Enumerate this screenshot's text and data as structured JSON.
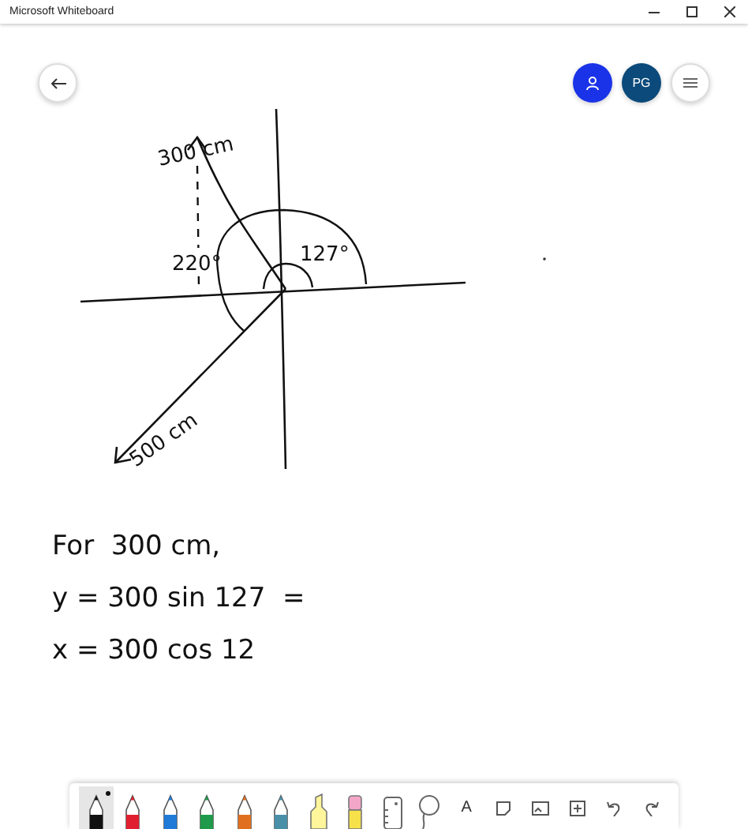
{
  "window": {
    "title": "Microsoft Whiteboard"
  },
  "header": {
    "avatars": [
      {
        "kind": "icon",
        "color": "#1a33e8"
      },
      {
        "kind": "initials",
        "initials": "PG",
        "color": "#0b4a7a"
      }
    ]
  },
  "canvas": {
    "labels": [
      {
        "text": "300 cm"
      },
      {
        "text": "220°"
      },
      {
        "text": "127°"
      },
      {
        "text": "500 cm"
      }
    ],
    "notes": [
      "For  300 cm,",
      "y = 300 sin 127  =",
      "x = 300 cos 12"
    ]
  },
  "toolbar": {
    "tools": [
      {
        "kind": "pen",
        "color": "#111111",
        "selected": true
      },
      {
        "kind": "pen",
        "color": "#e02030",
        "selected": false
      },
      {
        "kind": "pen",
        "color": "#1f7ad8",
        "selected": false
      },
      {
        "kind": "pen",
        "color": "#1f9a4a",
        "selected": false
      },
      {
        "kind": "pen",
        "color": "#e07020",
        "selected": false
      },
      {
        "kind": "pen",
        "color": "#4a8fa8",
        "selected": false
      },
      {
        "kind": "highlighter",
        "selected": false
      },
      {
        "kind": "eraser",
        "selected": false
      },
      {
        "kind": "ruler",
        "selected": false
      },
      {
        "kind": "lasso",
        "selected": false
      },
      {
        "kind": "text",
        "label": "A",
        "selected": false
      },
      {
        "kind": "note",
        "selected": false
      },
      {
        "kind": "image",
        "selected": false
      },
      {
        "kind": "insert",
        "selected": false
      },
      {
        "kind": "undo",
        "selected": false
      },
      {
        "kind": "redo",
        "selected": false
      }
    ]
  }
}
